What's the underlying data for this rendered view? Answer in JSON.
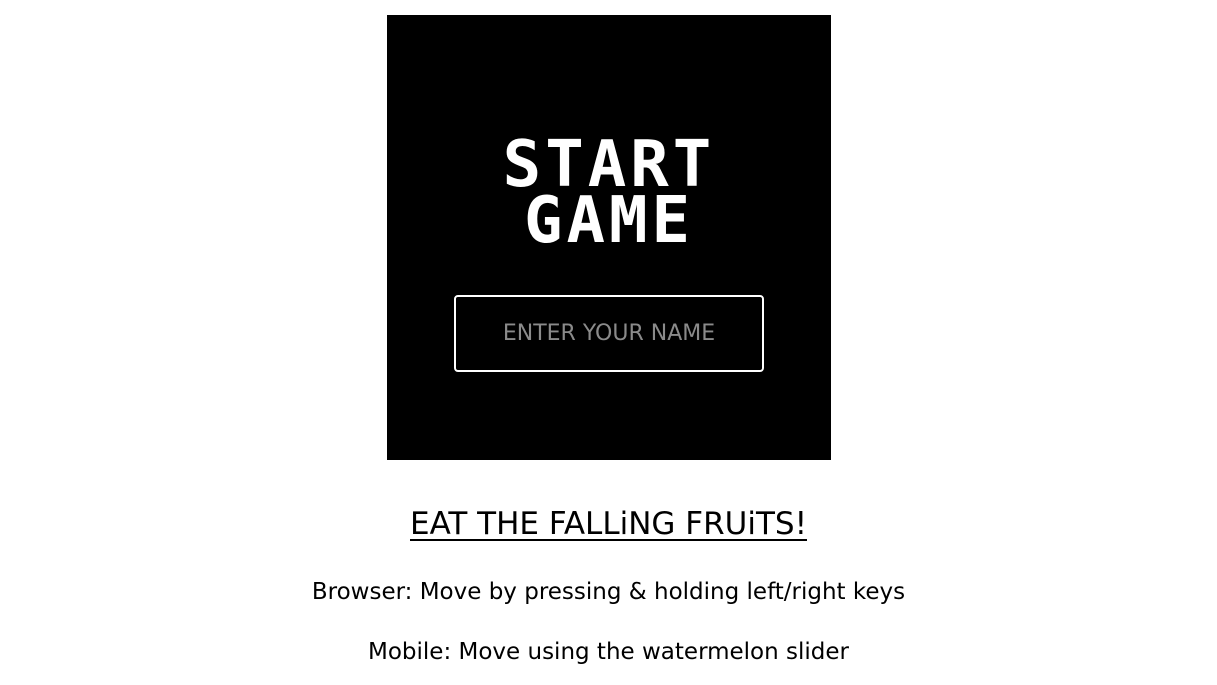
{
  "start_screen": {
    "title_line1": "START",
    "title_line2": "GAME",
    "name_input": {
      "value": "",
      "placeholder": "ENTER YOUR NAME"
    }
  },
  "instructions": {
    "heading": "EAT THE FALLiNG FRUiTS!",
    "browser": "Browser: Move by pressing & holding left/right keys",
    "mobile": "Mobile: Move using the watermelon slider"
  },
  "colors": {
    "panel_background": "#000000",
    "title_text": "#ffffff",
    "placeholder_text": "#8a8a8a",
    "page_background": "#ffffff"
  }
}
